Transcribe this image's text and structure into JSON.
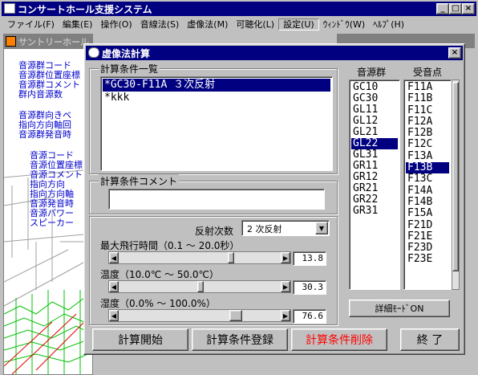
{
  "app": {
    "title": "コンサートホール支援システム"
  },
  "menu": [
    "ファイル(F)",
    "編集(E)",
    "操作(O)",
    "音線法(S)",
    "虚像法(M)",
    "可聴化(L)",
    "設定(U)",
    "ｳｨﾝﾄﾞｳ(W)",
    "ﾍﾙﾌﾟ(H)"
  ],
  "bg_window": {
    "title": "サントリーホール",
    "lines": [
      "音源群コード",
      "音源群位置座標",
      "音源群コメント",
      "群内音源数",
      "音源群向きベ",
      "指向方向軸回",
      "音源群発音時",
      "音源コード",
      "音源位置座標",
      "音源コメント",
      "指向方向",
      "指向方向軸",
      "音源発音時",
      "音源パワー",
      "スピーカー"
    ]
  },
  "dialog": {
    "title": "虚像法計算",
    "conditions_label": "計算条件一覧",
    "conditions": [
      "*GC30-F11A ３次反射",
      "*kkk"
    ],
    "comment_label": "計算条件コメント",
    "comment_value": "",
    "reflection_label": "反射次数",
    "reflection_value": "2 次反射",
    "flight_label": "最大飛行時間（0.1 ～ 20.0秒）",
    "flight_value": "13.8",
    "temp_label": "温度（10.0℃ ～ 50.0℃）",
    "temp_value": "30.3",
    "humidity_label": "湿度（0.0% ～ 100.0%）",
    "humidity_value": "76.6",
    "source_group_label": "音源群",
    "source_groups": [
      "GC10",
      "GC30",
      "GL11",
      "GL12",
      "GL21",
      "GL22",
      "GL31",
      "GR11",
      "GR12",
      "GR21",
      "GR22",
      "GR31"
    ],
    "receiver_label": "受音点",
    "receivers": [
      "F11A",
      "F11B",
      "F11C",
      "F12A",
      "F12B",
      "F12C",
      "F13A",
      "F13B",
      "F13C",
      "F14A",
      "F14B",
      "F15A",
      "F21D",
      "F21E",
      "F23D",
      "F23E"
    ],
    "detail_mode_button": "詳細ﾓｰﾄﾞON",
    "buttons": {
      "start": "計算開始",
      "register": "計算条件登録",
      "delete": "計算条件削除",
      "end": "終 了"
    }
  },
  "colors": {
    "titlebar": "#000080",
    "delete_text": "#ff0000",
    "selection": "#000080"
  }
}
